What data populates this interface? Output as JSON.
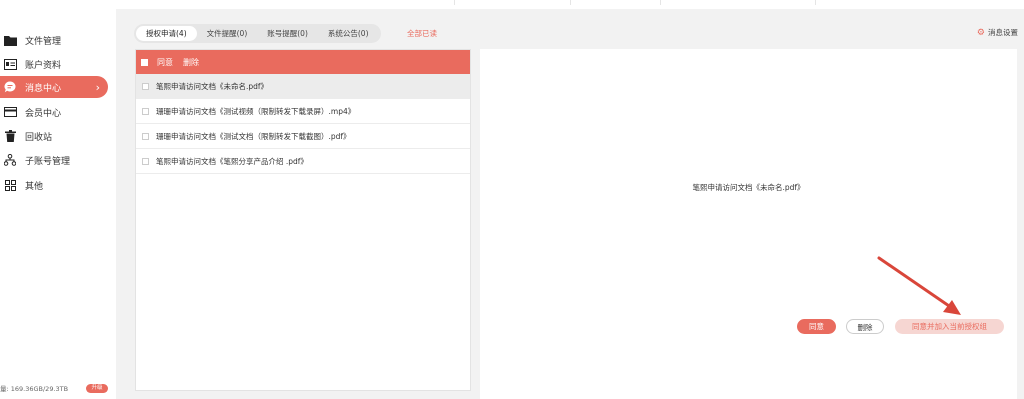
{
  "sidebar": {
    "items": [
      {
        "label": "文件管理",
        "icon": "folder-icon"
      },
      {
        "label": "账户资料",
        "icon": "id-card-icon"
      },
      {
        "label": "消息中心",
        "icon": "chat-bubble-icon",
        "active": true
      },
      {
        "label": "会员中心",
        "icon": "member-card-icon"
      },
      {
        "label": "回收站",
        "icon": "trash-icon"
      },
      {
        "label": "子账号管理",
        "icon": "org-tree-icon"
      },
      {
        "label": "其他",
        "icon": "grid-icon"
      }
    ],
    "storage_text": "量: 169.36GB/29.3TB",
    "upgrade_label": "升级"
  },
  "tabs": [
    {
      "label": "授权申请(4)",
      "active": true
    },
    {
      "label": "文件提醒(0)"
    },
    {
      "label": "账号提醒(0)"
    },
    {
      "label": "系统公告(0)"
    }
  ],
  "mark_all_read": "全部已读",
  "settings_label": "消息设置",
  "list": {
    "agree_label": "同意",
    "delete_label": "删除",
    "rows": [
      {
        "text": "笔熙申请访问文档《未命名.pdf》",
        "selected": true
      },
      {
        "text": "珊珊申请访问文档《测试视频（限制转发下载录屏）.mp4》"
      },
      {
        "text": "珊珊申请访问文档《测试文档（限制转发下载截图）.pdf》"
      },
      {
        "text": "笔熙申请访问文档《笔熙分享产品介绍 .pdf》"
      }
    ]
  },
  "detail": {
    "title": "笔熙申请访问文档《未命名.pdf》",
    "agree_label": "同意",
    "delete_label": "删除",
    "agree_group_label": "同意并加入当前授权组"
  },
  "colors": {
    "accent": "#e96b5e",
    "annotation_arrow": "#d9463a"
  }
}
